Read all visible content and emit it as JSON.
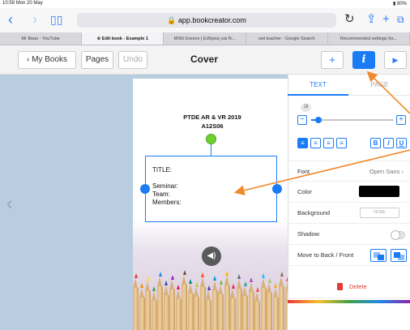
{
  "status_bar": {
    "time": "10:59",
    "date": "Mon 20 May",
    "battery": "80%"
  },
  "browser": {
    "url": "app.bookcreator.com",
    "tabs": [
      {
        "label": "Mr Bean - YouTube",
        "active": false
      },
      {
        "label": "Edit book - Example 1",
        "active": true
      },
      {
        "label": "MSN Greece | Ειδήσεις και Ν...",
        "active": false
      },
      {
        "label": "owl teacher - Google Search",
        "active": false
      },
      {
        "label": "Recommended settings for...",
        "active": false
      }
    ]
  },
  "toolbar": {
    "my_books": "My Books",
    "pages": "Pages",
    "undo": "Undo",
    "title": "Cover",
    "add": "+",
    "info": "i",
    "play": "▶"
  },
  "page": {
    "heading_line1": "PTDE AR & VR 2019",
    "heading_line2": "A12S06",
    "text_box_lines": [
      "TITLE:",
      "",
      "Seminar:",
      "Team:",
      "Members:"
    ]
  },
  "panel": {
    "tabs": [
      "TEXT",
      "PAGE"
    ],
    "font_size": "18",
    "minus": "−",
    "plus": "+",
    "bold": "B",
    "italic": "I",
    "underline": "U",
    "rows": {
      "font_label": "Font",
      "font_value": "Open Sans",
      "color_label": "Color",
      "background_label": "Background",
      "background_value": "NONE",
      "shadow_label": "Shadow",
      "layer_label": "Move to Back / Front"
    },
    "delete": "Delete"
  },
  "colors": {
    "accent": "#1a7cf5",
    "canvas": "#b9cde0",
    "handle_green": "#6dd12c",
    "delete_red": "#e53935",
    "annotation_arrow": "#f08a2e"
  }
}
